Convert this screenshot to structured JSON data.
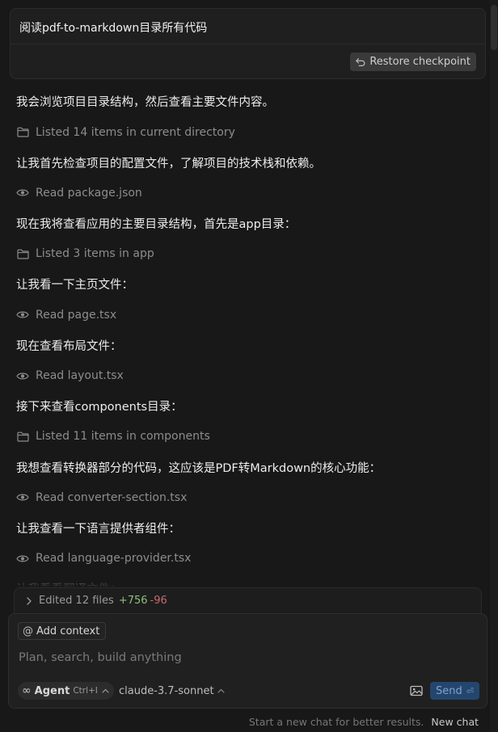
{
  "user_message": {
    "text": "阅读pdf-to-markdown目录所有代码",
    "restore_label": "Restore checkpoint"
  },
  "conversation": [
    {
      "kind": "text",
      "text": "我会浏览项目目录结构，然后查看主要文件内容。"
    },
    {
      "kind": "tool",
      "icon": "folder-icon",
      "text": "Listed 14 items in current directory"
    },
    {
      "kind": "text",
      "text": "让我首先检查项目的配置文件，了解项目的技术栈和依赖。"
    },
    {
      "kind": "tool",
      "icon": "eye-icon",
      "text": "Read package.json"
    },
    {
      "kind": "text",
      "text": "现在我将查看应用的主要目录结构，首先是app目录："
    },
    {
      "kind": "tool",
      "icon": "folder-icon",
      "text": "Listed 3 items in app"
    },
    {
      "kind": "text",
      "text": "让我看一下主页文件："
    },
    {
      "kind": "tool",
      "icon": "eye-icon",
      "text": "Read page.tsx"
    },
    {
      "kind": "text",
      "text": "现在查看布局文件："
    },
    {
      "kind": "tool",
      "icon": "eye-icon",
      "text": "Read layout.tsx"
    },
    {
      "kind": "text",
      "text": "接下来查看components目录："
    },
    {
      "kind": "tool",
      "icon": "folder-icon",
      "text": "Listed 11 items in components"
    },
    {
      "kind": "text",
      "text": "我想查看转换器部分的代码，这应该是PDF转Markdown的核心功能："
    },
    {
      "kind": "tool",
      "icon": "eye-icon",
      "text": "Read converter-section.tsx"
    },
    {
      "kind": "text",
      "text": "让我查看一下语言提供者组件："
    },
    {
      "kind": "tool",
      "icon": "eye-icon",
      "text": "Read language-provider.tsx"
    },
    {
      "kind": "text",
      "text": "让我看看翻译文件："
    }
  ],
  "edits": {
    "label": "Edited 12 files",
    "added": "+756",
    "removed": "-96"
  },
  "composer": {
    "context_label": "Add context",
    "placeholder": "Plan, search, build anything",
    "mode_label": "Agent",
    "mode_shortcut": "Ctrl+I",
    "model": "claude-3.7-sonnet",
    "send_label": "Send"
  },
  "footer": {
    "hint": "Start a new chat for better results.",
    "new_chat": "New chat"
  },
  "colors": {
    "background": "#181818",
    "card": "#1f1f1f",
    "added": "#8fbf7a",
    "removed": "#c66b6b",
    "send_bg": "#24466e"
  }
}
